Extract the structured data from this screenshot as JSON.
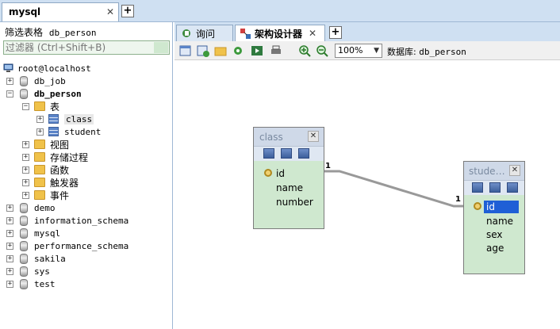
{
  "top_tab": {
    "label": "mysql",
    "close": "✕",
    "add": "+"
  },
  "left": {
    "filter_label": "筛选表格",
    "filter_db": "db_person",
    "filter_placeholder": "过滤器 (Ctrl+Shift+B)",
    "tree": {
      "root": "root@localhost",
      "dbs": [
        "db_job",
        "db_person",
        "demo",
        "information_schema",
        "mysql",
        "performance_schema",
        "sakila",
        "sys",
        "test"
      ],
      "db_person_children": {
        "tables_folder": "表",
        "tables": [
          "class",
          "student"
        ],
        "views": "视图",
        "procs": "存储过程",
        "funcs": "函数",
        "triggers": "触发器",
        "events": "事件"
      }
    }
  },
  "right_tabs": {
    "query": "询问",
    "designer": "架构设计器",
    "close": "✕",
    "add": "+"
  },
  "toolbar": {
    "zoom": "100%",
    "db_label": "数据库:",
    "db_value": "db_person"
  },
  "diagram": {
    "tables": [
      {
        "name": "class",
        "fields": [
          "id",
          "name",
          "number"
        ]
      },
      {
        "name": "stude…",
        "fields": [
          "id",
          "name",
          "sex",
          "age"
        ]
      }
    ],
    "relation": {
      "from_card": "1",
      "to_card": "1"
    }
  }
}
